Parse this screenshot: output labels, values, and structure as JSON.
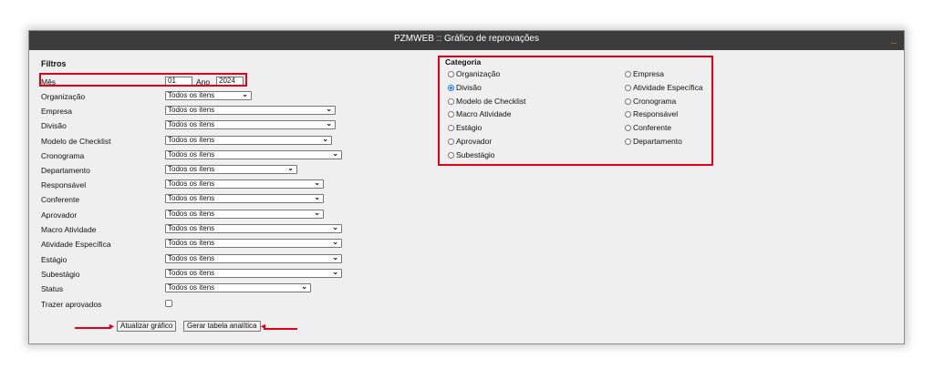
{
  "window": {
    "title": "PZMWEB :: Gráfico de reprovações",
    "minimize_glyph": "_"
  },
  "filters": {
    "heading": "Filtros",
    "month_label": "Mês",
    "month_value": "01",
    "year_label": "Ano",
    "year_value": "2024",
    "fields": [
      {
        "label": "Organização",
        "value": "Todos os itens"
      },
      {
        "label": "Empresa",
        "value": "Todos os itens"
      },
      {
        "label": "Divisão",
        "value": "Todos os itens"
      },
      {
        "label": "Modelo de Checklist",
        "value": "Todos os itens"
      },
      {
        "label": "Cronograma",
        "value": "Todos os itens"
      },
      {
        "label": "Departamento",
        "value": "Todos os itens"
      },
      {
        "label": "Responsável",
        "value": "Todos os itens"
      },
      {
        "label": "Conferente",
        "value": "Todos os itens"
      },
      {
        "label": "Aprovador",
        "value": "Todos os itens"
      },
      {
        "label": "Macro Atividade",
        "value": "Todos os itens"
      },
      {
        "label": "Atividade Específica",
        "value": "Todos os itens"
      },
      {
        "label": "Estágio",
        "value": "Todos os itens"
      },
      {
        "label": "Subestágio",
        "value": "Todos os itens"
      },
      {
        "label": "Status",
        "value": "Todos os itens"
      }
    ],
    "bring_approved_label": "Trazer aprovados",
    "bring_approved_checked": false
  },
  "buttons": {
    "update_chart": "Atualizar gráfico",
    "generate_table": "Gerar tabela analítica"
  },
  "category": {
    "heading": "Categoria",
    "selected": "Divisão",
    "left_options": [
      "Organização",
      "Divisão",
      "Modelo de Checklist",
      "Macro Atividade",
      "Estágio",
      "Aprovador",
      "Subestágio"
    ],
    "right_options": [
      "Empresa",
      "Atividade Específica",
      "Cronograma",
      "Responsável",
      "Conferente",
      "Departamento"
    ]
  },
  "colors": {
    "highlight": "#e3001b",
    "titlebar": "#3c3c3c",
    "radio_accent": "#1a73e8"
  }
}
